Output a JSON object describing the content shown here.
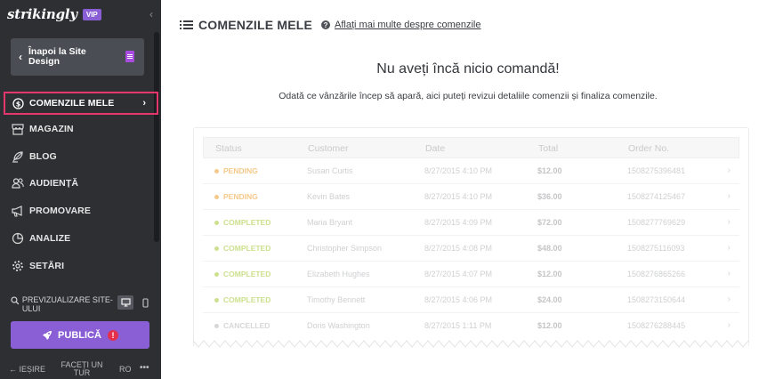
{
  "sidebar": {
    "logo": "strikingly",
    "badge": "VIP",
    "back_label": "Înapoi la Site Design",
    "items": [
      {
        "label": "COMENZILE MELE",
        "icon": "dollar-circle-icon"
      },
      {
        "label": "MAGAZIN",
        "icon": "store-icon"
      },
      {
        "label": "BLOG",
        "icon": "feather-icon"
      },
      {
        "label": "AUDIENȚĂ",
        "icon": "people-icon"
      },
      {
        "label": "PROMOVARE",
        "icon": "megaphone-icon"
      },
      {
        "label": "ANALIZE",
        "icon": "pie-chart-icon"
      },
      {
        "label": "SETĂRI",
        "icon": "gear-icon"
      }
    ],
    "preview_label": "PREVIZUALIZARE SITE-ULUI",
    "publish_label": "PUBLICĂ",
    "publish_alert": "!",
    "footer": {
      "exit": "IEȘIRE",
      "tour": "FACEȚI UN TUR",
      "lang": "RO",
      "more": "•••"
    }
  },
  "main": {
    "title": "COMENZILE MELE",
    "help_link": "Aflați mai multe despre comenzile",
    "empty_title": "Nu aveți încă nicio comandă!",
    "empty_subtitle": "Odată ce vânzările încep să apară, aici puteți revizui detaliile comenzii și finaliza comenzile.",
    "columns": [
      "Status",
      "Customer",
      "Date",
      "Total",
      "Order No."
    ],
    "rows": [
      {
        "status": "PENDING",
        "customer": "Susan Curtis",
        "date": "8/27/2015 4:10 PM",
        "total": "$12.00",
        "order": "1508275396481",
        "color": "#f5c98a"
      },
      {
        "status": "PENDING",
        "customer": "Kevin Bates",
        "date": "8/27/2015 4:10 PM",
        "total": "$36.00",
        "order": "1508274125467",
        "color": "#f5c98a"
      },
      {
        "status": "COMPLETED",
        "customer": "Maria Bryant",
        "date": "8/27/2015 4:09 PM",
        "total": "$72.00",
        "order": "1508277769629",
        "color": "#cde08e"
      },
      {
        "status": "COMPLETED",
        "customer": "Christopher Simpson",
        "date": "8/27/2015 4:08 PM",
        "total": "$48.00",
        "order": "1508275116093",
        "color": "#cde08e"
      },
      {
        "status": "COMPLETED",
        "customer": "Elizabeth Hughes",
        "date": "8/27/2015 4:07 PM",
        "total": "$12.00",
        "order": "1508276865266",
        "color": "#cde08e"
      },
      {
        "status": "COMPLETED",
        "customer": "Timothy Bennett",
        "date": "8/27/2015 4:06 PM",
        "total": "$24.00",
        "order": "1508273150644",
        "color": "#cde08e"
      },
      {
        "status": "CANCELLED",
        "customer": "Doris Washington",
        "date": "8/27/2015 1:11 PM",
        "total": "$12.00",
        "order": "1508276288445",
        "color": "#d6d7d9"
      }
    ]
  },
  "colors": {
    "sidebar_bg": "#2d2f33",
    "accent": "#8a5fd6",
    "active_border": "#e6366e"
  }
}
